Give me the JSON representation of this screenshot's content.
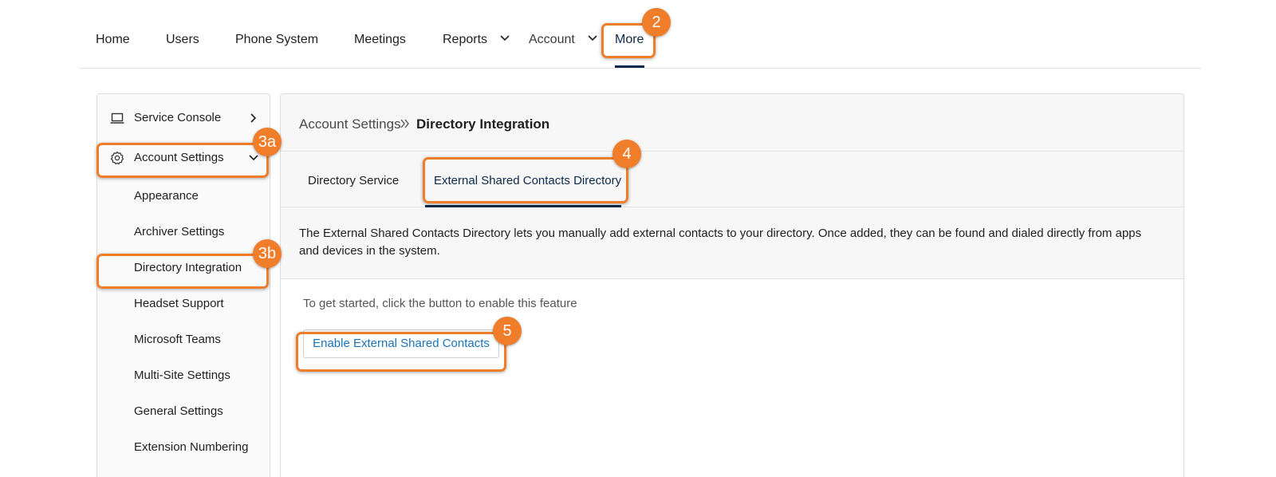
{
  "topnav": {
    "items": [
      {
        "label": "Home"
      },
      {
        "label": "Users"
      },
      {
        "label": "Phone System"
      },
      {
        "label": "Meetings"
      },
      {
        "label": "Reports"
      },
      {
        "label": "Account"
      },
      {
        "label": "More"
      }
    ],
    "active": "More"
  },
  "sidebar": {
    "service_console": "Service Console",
    "account_settings": "Account Settings",
    "sub_items": [
      {
        "label": "Appearance"
      },
      {
        "label": "Archiver Settings"
      },
      {
        "label": "Directory Integration"
      },
      {
        "label": "Headset Support"
      },
      {
        "label": "Microsoft Teams"
      },
      {
        "label": "Multi-Site Settings"
      },
      {
        "label": "General Settings"
      },
      {
        "label": "Extension Numbering"
      }
    ]
  },
  "breadcrumb": {
    "parent": "Account Settings",
    "current": "Directory Integration"
  },
  "tabs": [
    {
      "label": "Directory Service"
    },
    {
      "label": "External Shared Contacts Directory"
    }
  ],
  "main": {
    "description": "The External Shared Contacts Directory lets you manually add external contacts to your directory. Once added, they can be found and dialed directly from apps and devices in the system.",
    "hint": "To get started, click the button to enable this feature",
    "enable_button": "Enable External Shared Contacts"
  },
  "annotations": {
    "m2": "2",
    "m3a": "3a",
    "m3b": "3b",
    "m4": "4",
    "m5": "5"
  },
  "colors": {
    "highlight": "#f07d2a",
    "accent_navy": "#0b2a4a",
    "link_blue": "#1a73b8"
  }
}
